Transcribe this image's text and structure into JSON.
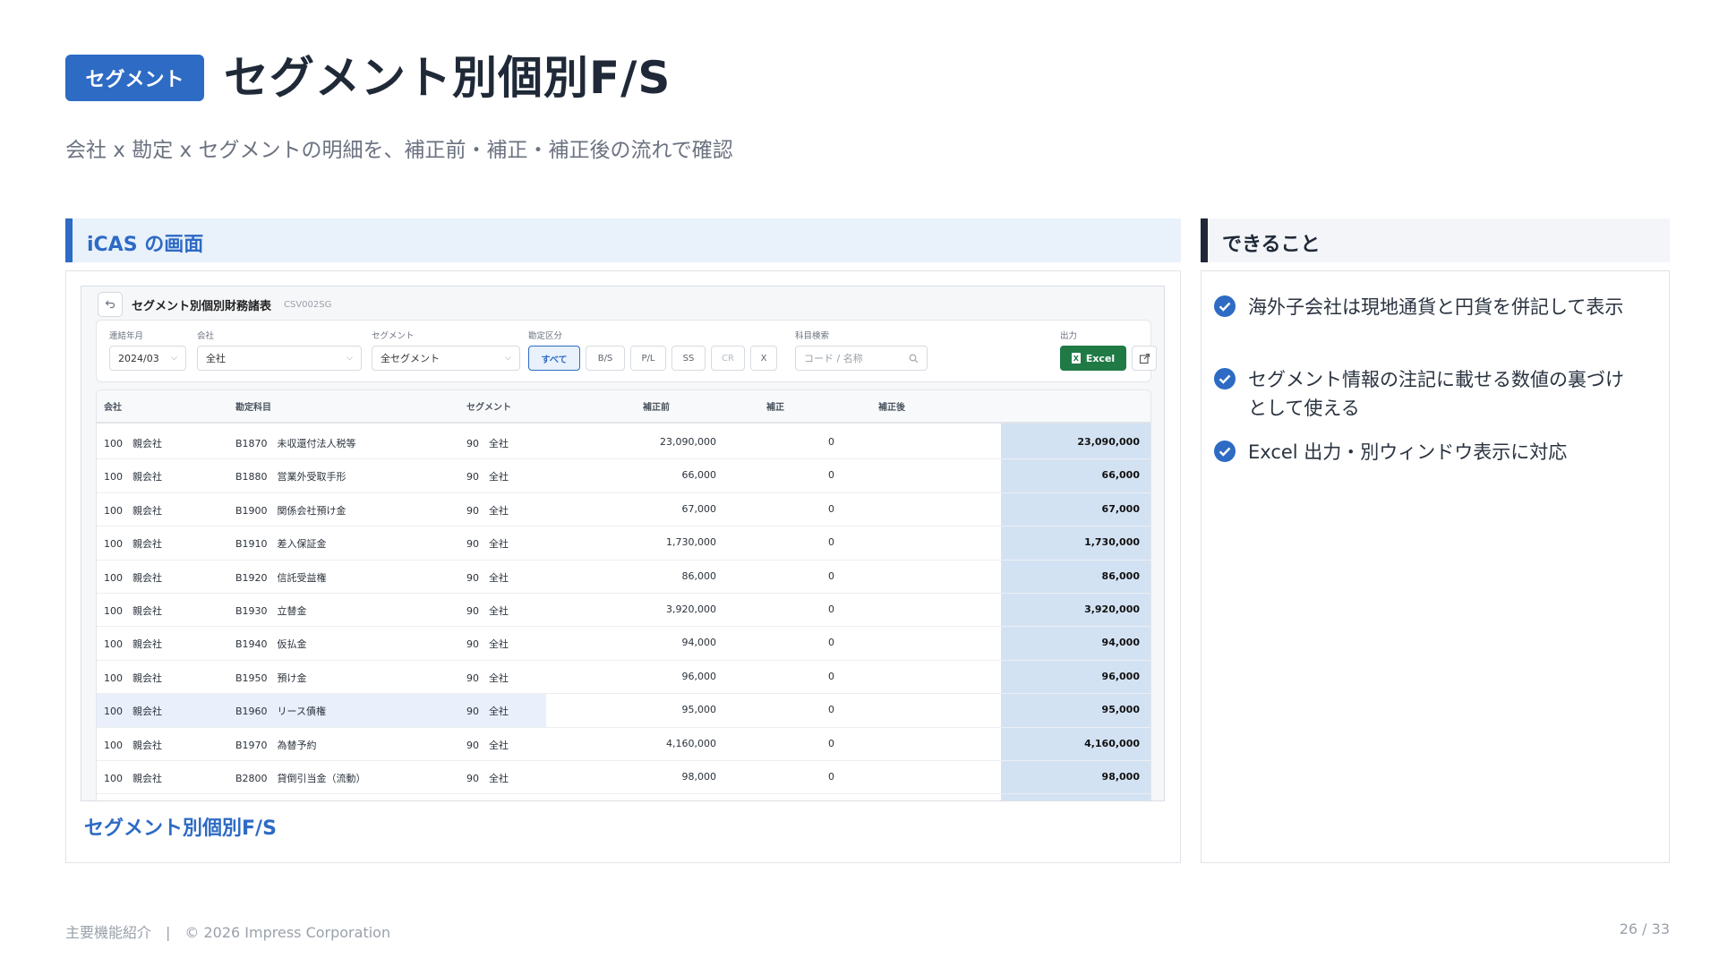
{
  "header": {
    "badge": "セグメント",
    "title": "セグメント別個別F/S",
    "subtitle": "会社 x 勘定 x セグメントの明細を、補正前・補正・補正後の流れで確認"
  },
  "left_section": {
    "title": "iCAS の画面",
    "caption": "セグメント別個別F/S"
  },
  "right_section": {
    "title": "できること",
    "features": [
      "海外子会社は現地通貨と円貨を併記して表示",
      "セグメント情報の注記に載せる数値の裏づけとして使える",
      "Excel 出力・別ウィンドウ表示に対応"
    ]
  },
  "screen": {
    "title": "セグメント別個別財務諸表",
    "code": "CSV002SG",
    "filters": {
      "period_label": "連結年月",
      "period_value": "2024/03",
      "company_label": "会社",
      "company_value": "全社",
      "segment_label": "セグメント",
      "segment_value": "全セグメント",
      "account_type_label": "勘定区分",
      "account_types": [
        "すべて",
        "B/S",
        "P/L",
        "SS",
        "CR",
        "X"
      ],
      "search_label": "科目検索",
      "search_placeholder": "コード / 名称",
      "output_label": "出力",
      "excel_label": "Excel"
    },
    "columns": [
      "会社",
      "勘定科目",
      "セグメント",
      "補正前",
      "補正",
      "補正後"
    ],
    "rows": [
      {
        "company": "100　親会社",
        "account": "B1870　未収還付法人税等",
        "segment": "90　全社",
        "pre": "23,090,000",
        "adj": "0",
        "post": "23,090,000"
      },
      {
        "company": "100　親会社",
        "account": "B1880　営業外受取手形",
        "segment": "90　全社",
        "pre": "66,000",
        "adj": "0",
        "post": "66,000"
      },
      {
        "company": "100　親会社",
        "account": "B1900　関係会社預け金",
        "segment": "90　全社",
        "pre": "67,000",
        "adj": "0",
        "post": "67,000"
      },
      {
        "company": "100　親会社",
        "account": "B1910　差入保証金",
        "segment": "90　全社",
        "pre": "1,730,000",
        "adj": "0",
        "post": "1,730,000"
      },
      {
        "company": "100　親会社",
        "account": "B1920　信託受益権",
        "segment": "90　全社",
        "pre": "86,000",
        "adj": "0",
        "post": "86,000"
      },
      {
        "company": "100　親会社",
        "account": "B1930　立替金",
        "segment": "90　全社",
        "pre": "3,920,000",
        "adj": "0",
        "post": "3,920,000"
      },
      {
        "company": "100　親会社",
        "account": "B1940　仮払金",
        "segment": "90　全社",
        "pre": "94,000",
        "adj": "0",
        "post": "94,000"
      },
      {
        "company": "100　親会社",
        "account": "B1950　預け金",
        "segment": "90　全社",
        "pre": "96,000",
        "adj": "0",
        "post": "96,000"
      },
      {
        "company": "100　親会社",
        "account": "B1960　リース債権",
        "segment": "90　全社",
        "pre": "95,000",
        "adj": "0",
        "post": "95,000"
      },
      {
        "company": "100　親会社",
        "account": "B1970　為替予約",
        "segment": "90　全社",
        "pre": "4,160,000",
        "adj": "0",
        "post": "4,160,000"
      },
      {
        "company": "100　親会社",
        "account": "B2800　貸倒引当金（流動）",
        "segment": "90　全社",
        "pre": "98,000",
        "adj": "0",
        "post": "98,000"
      }
    ]
  },
  "footer": {
    "left": "主要機能紹介　|　© 2026 Impress Corporation",
    "page": "26 / 33"
  },
  "colors": {
    "accent": "#2d6bc4",
    "excel_green": "#1f7a45",
    "highlight_col": "#d3e2f3"
  }
}
